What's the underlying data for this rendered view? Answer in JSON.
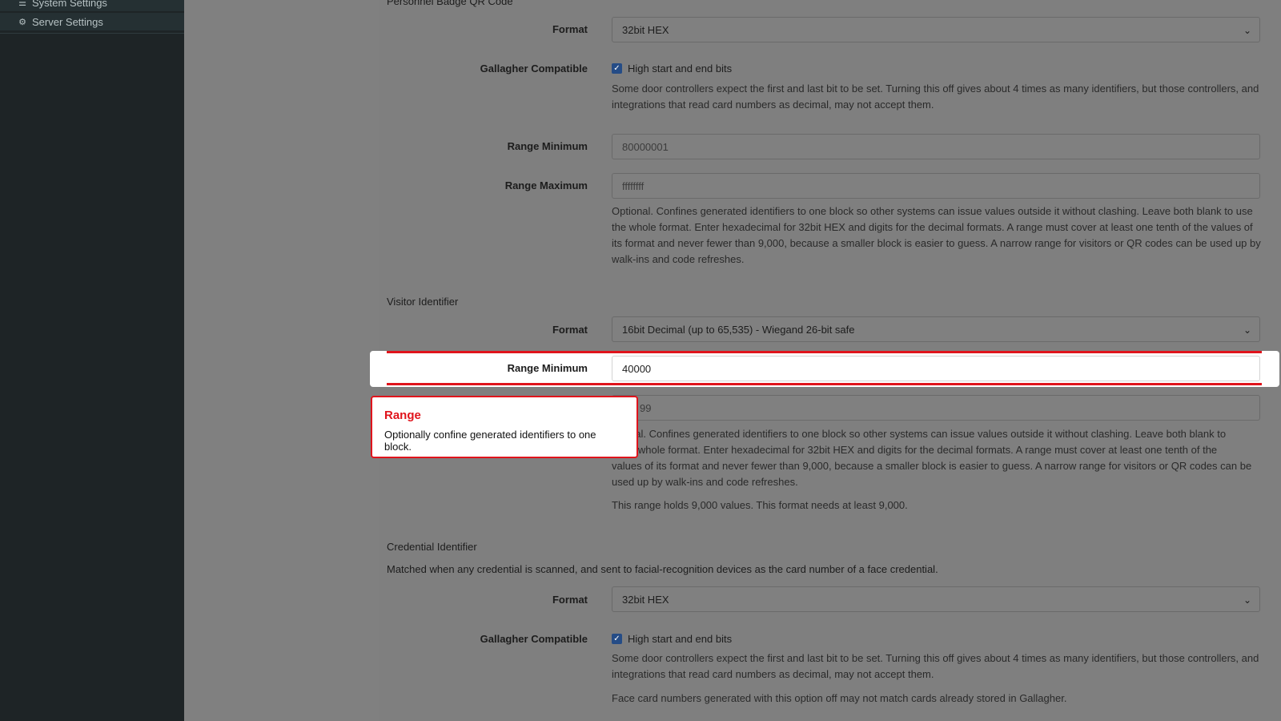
{
  "sidebar": {
    "items": [
      {
        "label": "System Settings",
        "icon": "sliders-icon"
      },
      {
        "label": "Server Settings",
        "icon": "server-gear-icon"
      }
    ]
  },
  "personnel_qr": {
    "title": "Personnel Badge QR Code",
    "format_label": "Format",
    "format_value": "32bit HEX",
    "gallagher_label": "Gallagher Compatible",
    "gallagher_checkbox": "High start and end bits",
    "gallagher_help": "Some door controllers expect the first and last bit to be set. Turning this off gives about 4 times as many identifiers, but those controllers, and integrations that read card numbers as decimal, may not accept them.",
    "range_min_label": "Range Minimum",
    "range_min_placeholder": "80000001",
    "range_max_label": "Range Maximum",
    "range_max_placeholder": "ffffffff",
    "range_help": "Optional. Confines generated identifiers to one block so other systems can issue values outside it without clashing. Leave both blank to use the whole format. Enter hexadecimal for 32bit HEX and digits for the decimal formats. A range must cover at least one tenth of the values of its format and never fewer than 9,000, because a smaller block is easier to guess. A narrow range for visitors or QR codes can be used up by walk-ins and code refreshes."
  },
  "visitor": {
    "title": "Visitor Identifier",
    "format_label": "Format",
    "format_value": "16bit Decimal (up to 65,535) - Wiegand 26-bit safe",
    "range_min_label": "Range Minimum",
    "range_min_value": "40000",
    "range_max_value_visible": "99",
    "range_help_visible_lines": [
      "nal. Confines generated identifiers to one block so other systems can issue values outside it without clashing. Leave both blank to",
      "e whole format. Enter hexadecimal for 32bit HEX and digits for the decimal formats. A range must cover at least one tenth of the",
      "values of its format and never fewer than 9,000, because a smaller block is easier to guess. A narrow range for visitors or QR codes can be",
      "used up by walk-ins and code refreshes."
    ],
    "range_status": "This range holds 9,000 values. This format needs at least 9,000."
  },
  "credential": {
    "title": "Credential Identifier",
    "description": "Matched when any credential is scanned, and sent to facial-recognition devices as the card number of a face credential.",
    "format_label": "Format",
    "format_value": "32bit HEX",
    "gallagher_label": "Gallagher Compatible",
    "gallagher_checkbox": "High start and end bits",
    "gallagher_help": "Some door controllers expect the first and last bit to be set. Turning this off gives about 4 times as many identifiers, but those controllers, and integrations that read card numbers as decimal, may not accept them.",
    "face_note": "Face card numbers generated with this option off may not match cards already stored in Gallagher."
  },
  "tooltip": {
    "title": "Range",
    "body": "Optionally confine generated identifiers to one block."
  },
  "colors": {
    "accent_red": "#e0141c",
    "checkbox_blue": "#254c86",
    "sidebar_bg": "#1e2426"
  }
}
